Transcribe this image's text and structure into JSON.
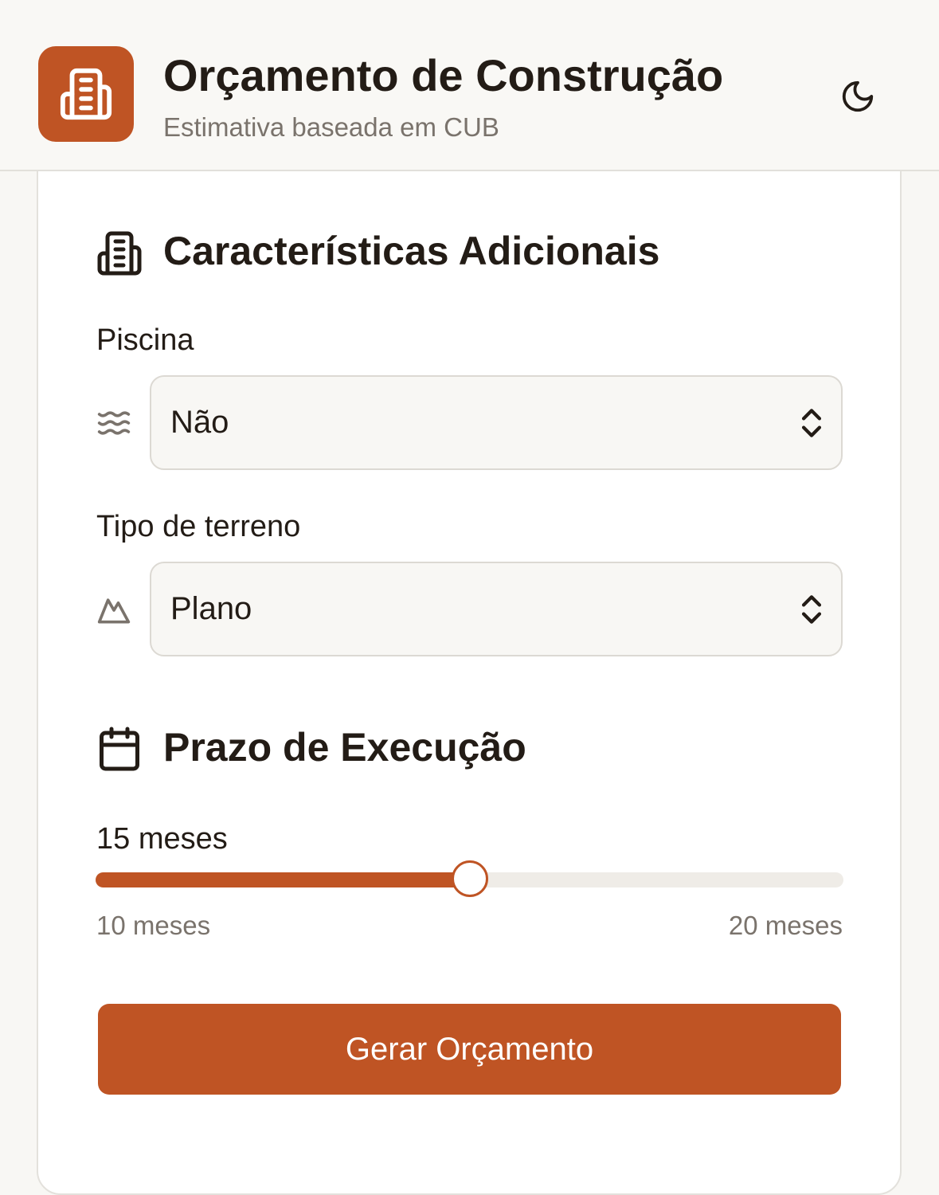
{
  "header": {
    "title": "Orçamento de Construção",
    "subtitle": "Estimativa baseada em CUB",
    "logo_icon": "building-icon",
    "theme_toggle_icon": "moon-icon"
  },
  "sections": {
    "additional": {
      "title": "Características Adicionais",
      "icon": "building-icon",
      "pool": {
        "label": "Piscina",
        "icon": "waves-icon",
        "value": "Não"
      },
      "terrain": {
        "label": "Tipo de terreno",
        "icon": "mountain-icon",
        "value": "Plano"
      }
    },
    "schedule": {
      "title": "Prazo de Execução",
      "icon": "calendar-icon",
      "slider": {
        "value": 15,
        "min": 10,
        "max": 20,
        "value_label": "15 meses",
        "min_label": "10 meses",
        "max_label": "20 meses"
      }
    }
  },
  "actions": {
    "submit_label": "Gerar Orçamento"
  },
  "colors": {
    "accent": "#bf5424",
    "background": "#f8f7f4",
    "card": "#ffffff",
    "text": "#231c16",
    "muted": "#7a736c"
  }
}
